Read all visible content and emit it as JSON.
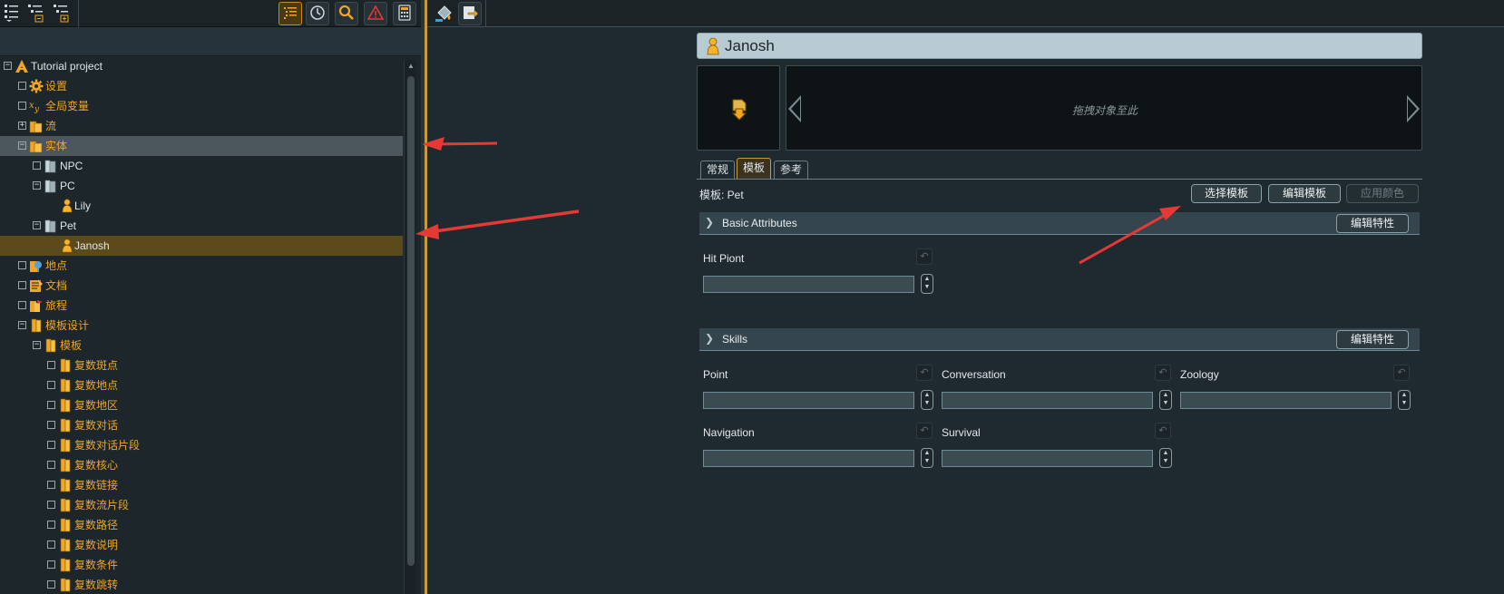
{
  "left_tree": {
    "items": [
      {
        "label": "Tutorial project",
        "color": "white",
        "indent": 0,
        "expander": "−",
        "icon": "project-icon"
      },
      {
        "label": "设置",
        "color": "gold",
        "indent": 1,
        "expander": "",
        "icon": "gear-icon"
      },
      {
        "label": "全局变量",
        "color": "gold",
        "indent": 1,
        "expander": "",
        "icon": "variable-icon"
      },
      {
        "label": "流",
        "color": "gold",
        "indent": 1,
        "expander": "+",
        "icon": "folder-icon"
      },
      {
        "label": "实体",
        "color": "gold",
        "indent": 1,
        "expander": "−",
        "icon": "folder-icon",
        "highlight": "gray"
      },
      {
        "label": "NPC",
        "color": "white",
        "indent": 2,
        "expander": "",
        "icon": "template-folder-icon"
      },
      {
        "label": "PC",
        "color": "white",
        "indent": 2,
        "expander": "−",
        "icon": "template-folder-icon"
      },
      {
        "label": "Lily",
        "color": "white",
        "indent": 3,
        "expander": "none",
        "icon": "entity-icon"
      },
      {
        "label": "Pet",
        "color": "white",
        "indent": 2,
        "expander": "−",
        "icon": "template-folder-icon"
      },
      {
        "label": "Janosh",
        "color": "white",
        "indent": 3,
        "expander": "none",
        "icon": "entity-icon",
        "highlight": "gold"
      },
      {
        "label": "地点",
        "color": "gold",
        "indent": 1,
        "expander": "",
        "icon": "location-icon"
      },
      {
        "label": "文档",
        "color": "gold",
        "indent": 1,
        "expander": "",
        "icon": "document-icon"
      },
      {
        "label": "旅程",
        "color": "gold",
        "indent": 1,
        "expander": "",
        "icon": "journey-icon"
      },
      {
        "label": "模板设计",
        "color": "gold",
        "indent": 1,
        "expander": "−",
        "icon": "book-icon"
      },
      {
        "label": "模板",
        "color": "gold",
        "indent": 2,
        "expander": "−",
        "icon": "book-icon"
      },
      {
        "label": "复数斑点",
        "color": "gold",
        "indent": 3,
        "expander": "",
        "icon": "book-icon"
      },
      {
        "label": "复数地点",
        "color": "gold",
        "indent": 3,
        "expander": "",
        "icon": "book-icon"
      },
      {
        "label": "复数地区",
        "color": "gold",
        "indent": 3,
        "expander": "",
        "icon": "book-icon"
      },
      {
        "label": "复数对话",
        "color": "gold",
        "indent": 3,
        "expander": "",
        "icon": "book-icon"
      },
      {
        "label": "复数对话片段",
        "color": "gold",
        "indent": 3,
        "expander": "",
        "icon": "book-icon"
      },
      {
        "label": "复数核心",
        "color": "gold",
        "indent": 3,
        "expander": "",
        "icon": "book-icon"
      },
      {
        "label": "复数链接",
        "color": "gold",
        "indent": 3,
        "expander": "",
        "icon": "book-icon"
      },
      {
        "label": "复数流片段",
        "color": "gold",
        "indent": 3,
        "expander": "",
        "icon": "book-icon"
      },
      {
        "label": "复数路径",
        "color": "gold",
        "indent": 3,
        "expander": "",
        "icon": "book-icon"
      },
      {
        "label": "复数说明",
        "color": "gold",
        "indent": 3,
        "expander": "",
        "icon": "book-icon"
      },
      {
        "label": "复数条件",
        "color": "gold",
        "indent": 3,
        "expander": "",
        "icon": "book-icon"
      },
      {
        "label": "复数跳转",
        "color": "gold",
        "indent": 3,
        "expander": "",
        "icon": "book-icon"
      }
    ]
  },
  "entity": {
    "title": "Janosh",
    "drop_hint": "拖拽对象至此"
  },
  "tabs": [
    "常规",
    "模板",
    "参考"
  ],
  "template": {
    "label": "模板:  Pet",
    "select_button": "选择模板",
    "edit_button": "编辑模板",
    "apply_color_button": "应用颜色"
  },
  "sections": {
    "basic": {
      "title": "Basic Attributes",
      "edit_button": "编辑特性",
      "fields": [
        "Hit Piont"
      ]
    },
    "skills": {
      "title": "Skills",
      "edit_button": "编辑特性",
      "fields": [
        "Point",
        "Conversation",
        "Zoology",
        "Navigation",
        "Survival"
      ]
    }
  },
  "icons": {
    "left_toolbar": [
      "tree-view-icon",
      "tree-collapse-icon",
      "tree-expand-icon",
      "list-icon",
      "clock-icon",
      "search-icon",
      "warning-icon",
      "calculator-icon"
    ],
    "right_toolbar": [
      "paint-bucket-icon",
      "export-icon"
    ]
  },
  "colors": {
    "accent_gold": "#f0a623",
    "arrow_red": "#e53935"
  }
}
